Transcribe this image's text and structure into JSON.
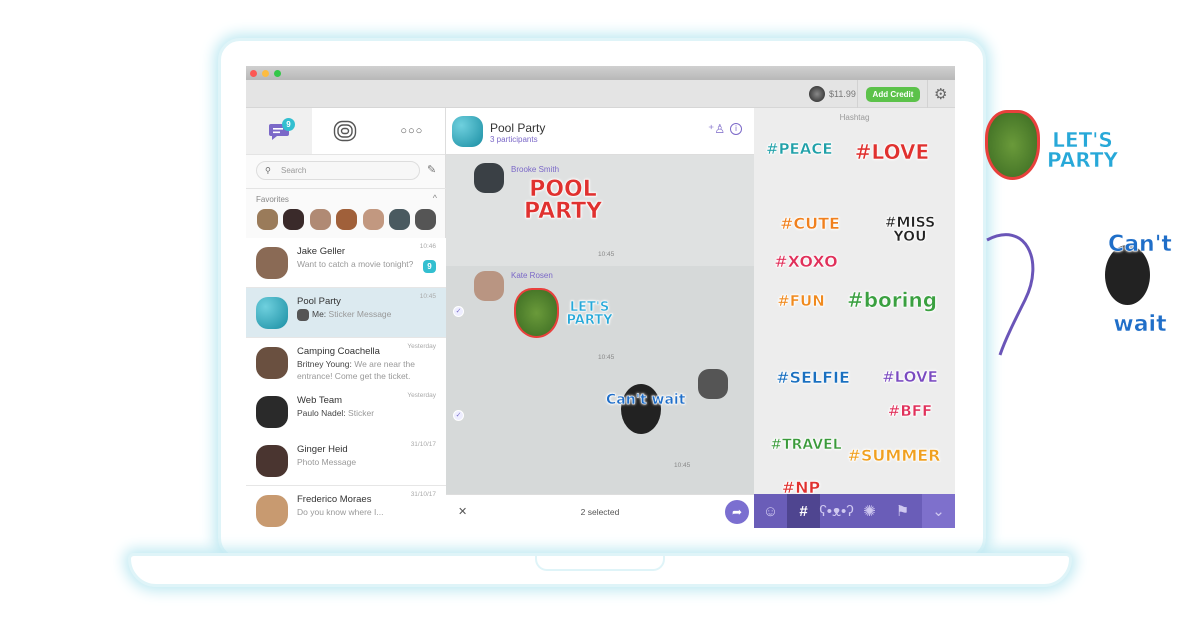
{
  "toolbar": {
    "balance": "$11.99",
    "add_credit": "Add Credit"
  },
  "sidebar": {
    "chats_badge": "9",
    "search_placeholder": "Search",
    "favorites_label": "Favorites",
    "items": [
      {
        "name": "Jake Geller",
        "sender": "",
        "message": "Want to catch a movie tonight?",
        "time": "10:46",
        "badge": "9"
      },
      {
        "name": "Pool Party",
        "sender": "Me:",
        "message": "Sticker Message",
        "time": "10:45"
      },
      {
        "name": "Camping Coachella",
        "sender": "Britney Young:",
        "message": "We are near the entrance! Come get the ticket.",
        "time": "Yesterday"
      },
      {
        "name": "Web Team",
        "sender": "Paulo Nadel:",
        "message": "Sticker",
        "time": "Yesterday"
      },
      {
        "name": "Ginger Heid",
        "sender": "",
        "message": "Photo Message",
        "time": "31/10/17"
      },
      {
        "name": "Frederico Moraes",
        "sender": "",
        "message": "Do you know where I...",
        "time": "31/10/17"
      }
    ]
  },
  "chat": {
    "title": "Pool Party",
    "subtitle": "3 participants",
    "messages": [
      {
        "sender": "Brooke Smith",
        "sticker": "POOL PARTY",
        "time": "10:45"
      },
      {
        "sender": "Kate Rosen",
        "sticker": "LET'S PARTY",
        "time": "10:45"
      },
      {
        "sender": "",
        "sticker": "Can't wait",
        "time": "10:45"
      }
    ],
    "selected": "2 selected"
  },
  "panel": {
    "title": "Hashtag",
    "stickers": [
      "#PEACE",
      "#LOVE",
      "#CUTE",
      "#MISS YOU",
      "#XOXO",
      "#FUN",
      "#boring",
      "#SELFIE",
      "#LOVE",
      "#BFF",
      "#TRAVEL",
      "#SUMMER",
      "#NP"
    ],
    "tabs": [
      "emoji",
      "hashtag",
      "panda",
      "sun",
      "suit"
    ]
  },
  "floating": [
    "LET'S PARTY",
    "Can't wait"
  ],
  "colors": {
    "accent": "#7360c8",
    "green": "#5cc24a",
    "badge": "#33bfd0",
    "selected": "#dceaf0"
  }
}
